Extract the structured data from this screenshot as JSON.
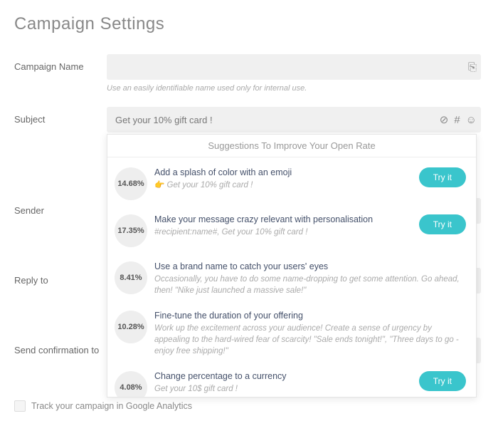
{
  "page_title": "Campaign Settings",
  "labels": {
    "campaign_name": "Campaign Name",
    "subject": "Subject",
    "sender": "Sender",
    "reply_to": "Reply to",
    "send_confirmation": "Send confirmation to"
  },
  "campaign_name": {
    "value": "",
    "hint": "Use an easily identifiable name used only for internal use."
  },
  "subject": {
    "value": "Get your 10% gift card !"
  },
  "icons": {
    "doc": "⎘",
    "ban": "⊘",
    "hash": "#",
    "smile": "☺",
    "chevron": "⌄"
  },
  "suggestions": {
    "header": "Suggestions To Improve Your Open Rate",
    "try_label": "Try it",
    "items": [
      {
        "pct": "14.68%",
        "title": "Add a splash of color with an emoji",
        "desc_prefix": "👉 ",
        "desc": "Get your 10% gift card !",
        "try": true
      },
      {
        "pct": "17.35%",
        "title": "Make your message crazy relevant with personalisation",
        "desc_prefix": "",
        "desc": "#recipient:name#, Get your 10% gift card !",
        "try": true
      },
      {
        "pct": "8.41%",
        "title": "Use a brand name to catch your users' eyes",
        "desc_prefix": "",
        "desc": "Occasionally, you have to do some name-dropping to get some attention. Go ahead, then! \"Nike just launched a massive sale!\"",
        "try": false
      },
      {
        "pct": "10.28%",
        "title": "Fine-tune the duration of your offering",
        "desc_prefix": "",
        "desc": "Work up the excitement across your audience! Create a sense of urgency by appealing to the hard-wired fear of scarcity! \"Sale ends tonight!\", \"Three days to go - enjoy free shipping!\"",
        "try": false
      },
      {
        "pct": "4.08%",
        "title": "Change percentage to a currency",
        "desc_prefix": "",
        "desc": "Get your 10$ gift card !",
        "try": true
      }
    ]
  },
  "track_label": "Track your campaign in Google Analytics"
}
